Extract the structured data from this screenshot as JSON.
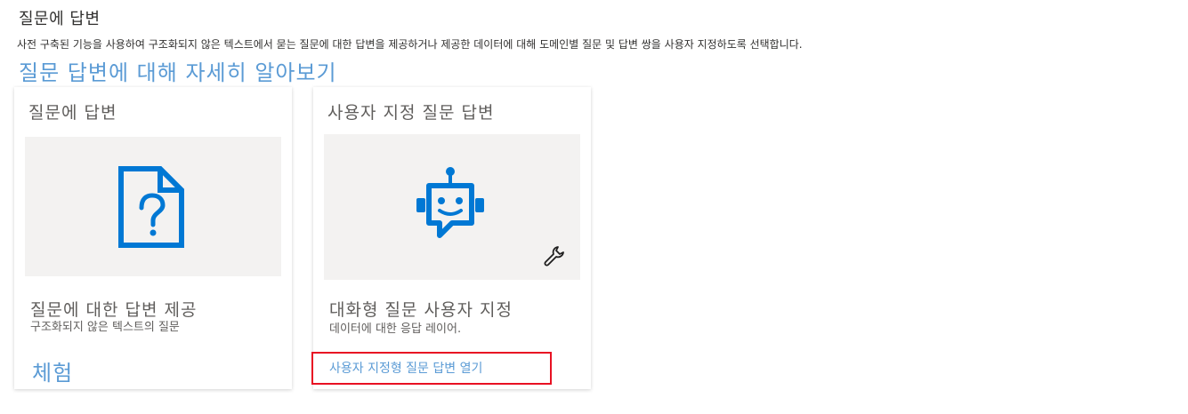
{
  "page": {
    "title": "질문에 답변",
    "description": "사전 구축된 기능을 사용하여 구조화되지 않은 텍스트에서 묻는 질문에 대한 답변을 제공하거나 제공한 데이터에 대해 도메인별 질문 및 답변 쌍을 사용자 지정하도록 선택합니다.",
    "learn_more_link": "질문 답변에 대해 자세히 알아보기"
  },
  "cards": [
    {
      "title": "질문에 답변",
      "icon": "document-question-icon",
      "heading": "질문에 대한 답변 제공",
      "subtext": "구조화되지 않은 텍스트의 질문",
      "action": "체험"
    },
    {
      "title": "사용자 지정 질문 답변",
      "icon": "chat-bot-icon",
      "badge_icon": "wrench-icon",
      "heading": "대화형 질문 사용자 지정",
      "subtext": "데이터에 대한 응답 레이어.",
      "action": "사용자 지정형 질문 답변 열기"
    }
  ],
  "colors": {
    "accent": "#5b9bd5",
    "icon_blue": "#0078d4",
    "image_bg": "#f3f2f1",
    "highlight": "#e81123"
  }
}
